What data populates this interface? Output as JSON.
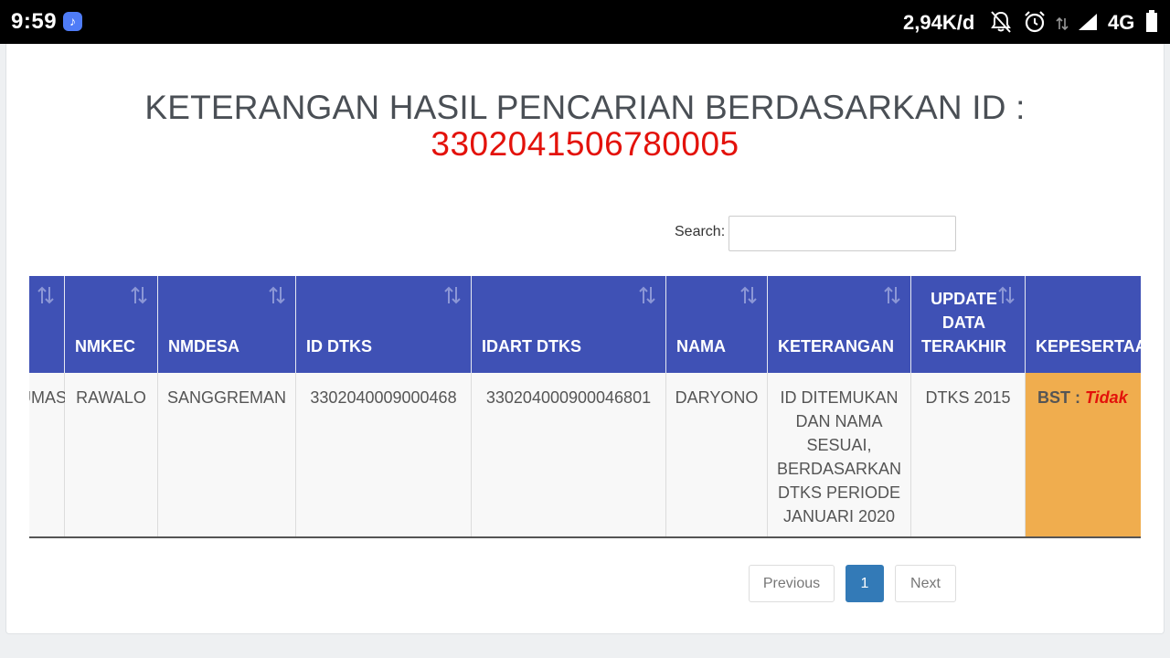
{
  "status_bar": {
    "time": "9:59",
    "music_icon": "♪",
    "speed": "2,94K/d",
    "network": "4G",
    "icons": [
      "bell-off-icon",
      "alarm-icon",
      "data-arrows-icon",
      "signal-icon",
      "battery-icon"
    ]
  },
  "page": {
    "title": "KETERANGAN HASIL PENCARIAN BERDASARKAN ID :",
    "id_value": "3302041506780005",
    "id_color": "#e3120b"
  },
  "search": {
    "label": "Search:",
    "value": "",
    "placeholder": ""
  },
  "table": {
    "header_color": "#3f51b5",
    "columns": [
      {
        "label": ""
      },
      {
        "label": "NMKEC"
      },
      {
        "label": "NMDESA"
      },
      {
        "label": "ID DTKS"
      },
      {
        "label": "IDART DTKS"
      },
      {
        "label": "NAMA"
      },
      {
        "label": "KETERANGAN"
      },
      {
        "label_lines": [
          "UPDATE",
          "DATA",
          "TERAKHIR"
        ]
      },
      {
        "label": "KEPESERTAAN"
      }
    ],
    "row": {
      "cell0": "BANYUMAS",
      "nmkec": "RAWALO",
      "nmdesa": "SANGGREMAN",
      "id_dtks": "3302040009000468",
      "idart_dtks": "330204000900046801",
      "nama": "DARYONO",
      "keterangan_lines": [
        "ID DITEMUKAN",
        "DAN NAMA",
        "SESUAI,",
        "BERDASARKAN",
        "DTKS PERIODE",
        "JANUARI 2020"
      ],
      "update": "DTKS 2015",
      "kepesertaan_label": "BST :",
      "kepesertaan_value": "Tidak",
      "kepesertaan_bg": "#f0ad4e"
    }
  },
  "pagination": {
    "previous": "Previous",
    "current": "1",
    "next": "Next",
    "active_color": "#337ab7"
  }
}
